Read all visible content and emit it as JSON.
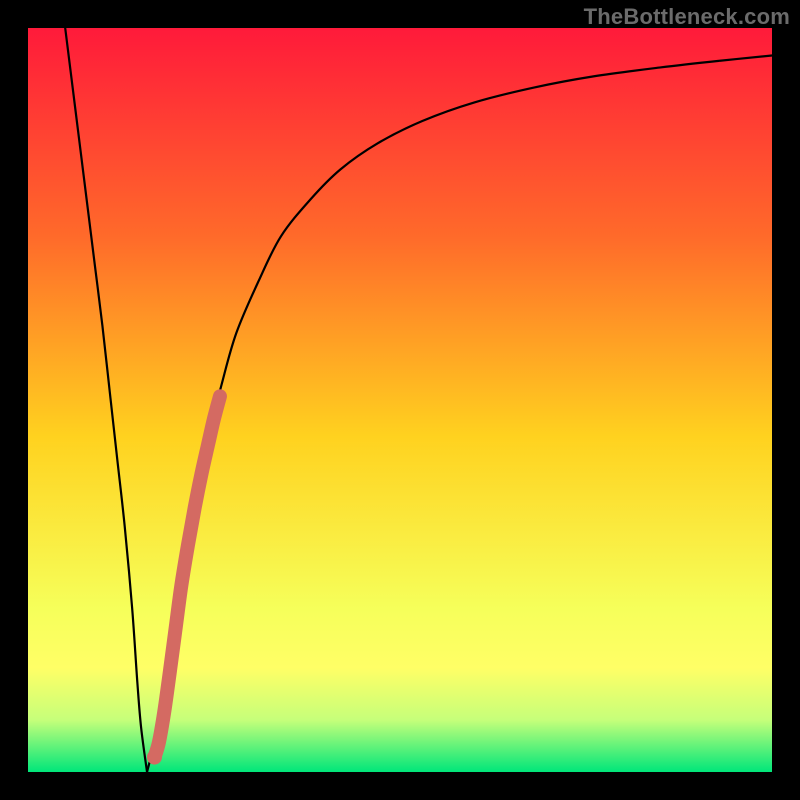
{
  "watermark": "TheBottleneck.com",
  "colors": {
    "frame": "#000000",
    "gradient_top": "#ff1a3a",
    "gradient_mid_upper": "#ff6a2a",
    "gradient_mid": "#ffd21f",
    "gradient_lower": "#f6ff5a",
    "gradient_band_yellow": "#ffff66",
    "gradient_band_lightgreen": "#c6ff7a",
    "gradient_bottom": "#00e67a",
    "curve": "#000000",
    "highlight": "#d46a62"
  },
  "chart_data": {
    "type": "line",
    "title": "",
    "xlabel": "",
    "ylabel": "",
    "xlim": [
      0,
      100
    ],
    "ylim": [
      0,
      100
    ],
    "series": [
      {
        "name": "left-branch",
        "x": [
          5,
          6,
          7,
          8,
          9,
          10,
          11,
          12,
          13,
          14,
          14.7,
          15.2,
          16
        ],
        "y": [
          100,
          92,
          84,
          76,
          68,
          60,
          51,
          42,
          33,
          22,
          12,
          6,
          0
        ]
      },
      {
        "name": "right-branch",
        "x": [
          16,
          17,
          18,
          19,
          20,
          22,
          24,
          26,
          28,
          31,
          34,
          38,
          42,
          47,
          53,
          60,
          68,
          76,
          85,
          93,
          100
        ],
        "y": [
          0,
          4,
          9,
          15,
          22,
          34,
          44,
          52,
          59,
          66,
          72,
          77,
          81,
          84.5,
          87.5,
          90,
          92,
          93.5,
          94.7,
          95.6,
          96.3
        ]
      }
    ],
    "highlight_segment": {
      "name": "overlay",
      "x": [
        17.0,
        17.6,
        18.3,
        19.0,
        19.8,
        20.6,
        21.5,
        22.4,
        23.3,
        24.2,
        25.0,
        25.8
      ],
      "y": [
        2.0,
        4.0,
        8.0,
        13.0,
        19.0,
        25.0,
        30.5,
        35.5,
        40.0,
        44.0,
        47.5,
        50.5
      ]
    }
  }
}
